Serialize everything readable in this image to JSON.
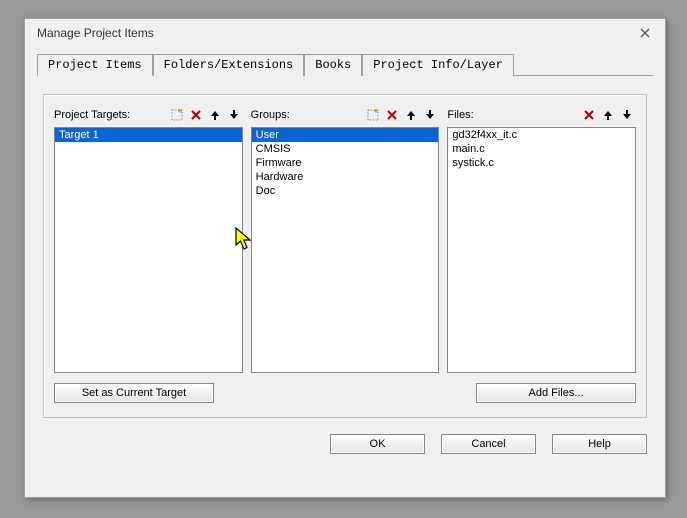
{
  "window": {
    "title": "Manage Project Items"
  },
  "tabs": {
    "items": [
      "Project Items",
      "Folders/Extensions",
      "Books",
      "Project Info/Layer"
    ],
    "active_index": 0
  },
  "columns": {
    "targets": {
      "label": "Project Targets:",
      "items": [
        "Target 1"
      ],
      "selected_index": 0
    },
    "groups": {
      "label": "Groups:",
      "items": [
        "User",
        "CMSIS",
        "Firmware",
        "Hardware",
        "Doc"
      ],
      "selected_index": 0
    },
    "files": {
      "label": "Files:",
      "items": [
        "gd32f4xx_it.c",
        "main.c",
        "systick.c"
      ],
      "selected_index": -1
    }
  },
  "buttons": {
    "set_current_target": "Set as Current Target",
    "add_files": "Add Files...",
    "ok": "OK",
    "cancel": "Cancel",
    "help": "Help"
  },
  "icons": {
    "new": "new-icon",
    "delete": "delete-icon",
    "up": "up-arrow-icon",
    "down": "down-arrow-icon",
    "close": "close-icon"
  }
}
